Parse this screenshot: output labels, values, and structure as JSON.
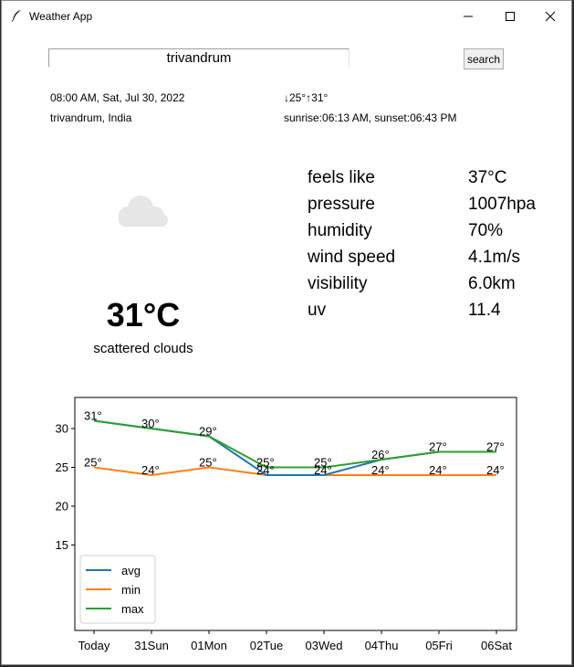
{
  "window": {
    "title": "Weather App"
  },
  "search": {
    "value": "trivandrum",
    "button_label": "search"
  },
  "info": {
    "datetime": "08:00 AM, Sat, Jul 30, 2022",
    "location": "trivandrum, India",
    "minmax": "↓25°↑31°",
    "sun": "sunrise:06:13 AM, sunset:06:43 PM"
  },
  "current": {
    "icon": "cloud-icon",
    "temperature": "31°C",
    "description": "scattered clouds"
  },
  "details": [
    {
      "label": "feels like",
      "value": "37°C"
    },
    {
      "label": "pressure",
      "value": "1007hpa"
    },
    {
      "label": "humidity",
      "value": "70%"
    },
    {
      "label": "wind speed",
      "value": "4.1m/s"
    },
    {
      "label": "visibility",
      "value": "6.0km"
    },
    {
      "label": "uv",
      "value": "11.4"
    }
  ],
  "chart_data": {
    "type": "line",
    "categories": [
      "Today",
      "31Sun",
      "01Mon",
      "02Tue",
      "03Wed",
      "04Thu",
      "05Fri",
      "06Sat"
    ],
    "series": [
      {
        "name": "avg",
        "color": "#1f77b4",
        "values": [
          31,
          30,
          29,
          24,
          24,
          26,
          27,
          27
        ]
      },
      {
        "name": "min",
        "color": "#ff7f0e",
        "values": [
          25,
          24,
          25,
          24,
          24,
          24,
          24,
          24
        ]
      },
      {
        "name": "max",
        "color": "#2ca02c",
        "values": [
          31,
          30,
          29,
          25,
          25,
          26,
          27,
          27
        ]
      }
    ],
    "point_labels": [
      {
        "series": "max",
        "labels": [
          "31°",
          "30°",
          "29°",
          "25°",
          "25°",
          "26°",
          "27°",
          "27°"
        ]
      },
      {
        "series": "min",
        "labels": [
          "25°",
          "24°",
          "25°",
          "24°",
          "24°",
          "24°",
          "24°",
          "24°"
        ]
      }
    ],
    "yticks": [
      15,
      20,
      25,
      30
    ],
    "ylim": [
      4,
      34
    ],
    "legend": "lower-left",
    "grid": false
  }
}
